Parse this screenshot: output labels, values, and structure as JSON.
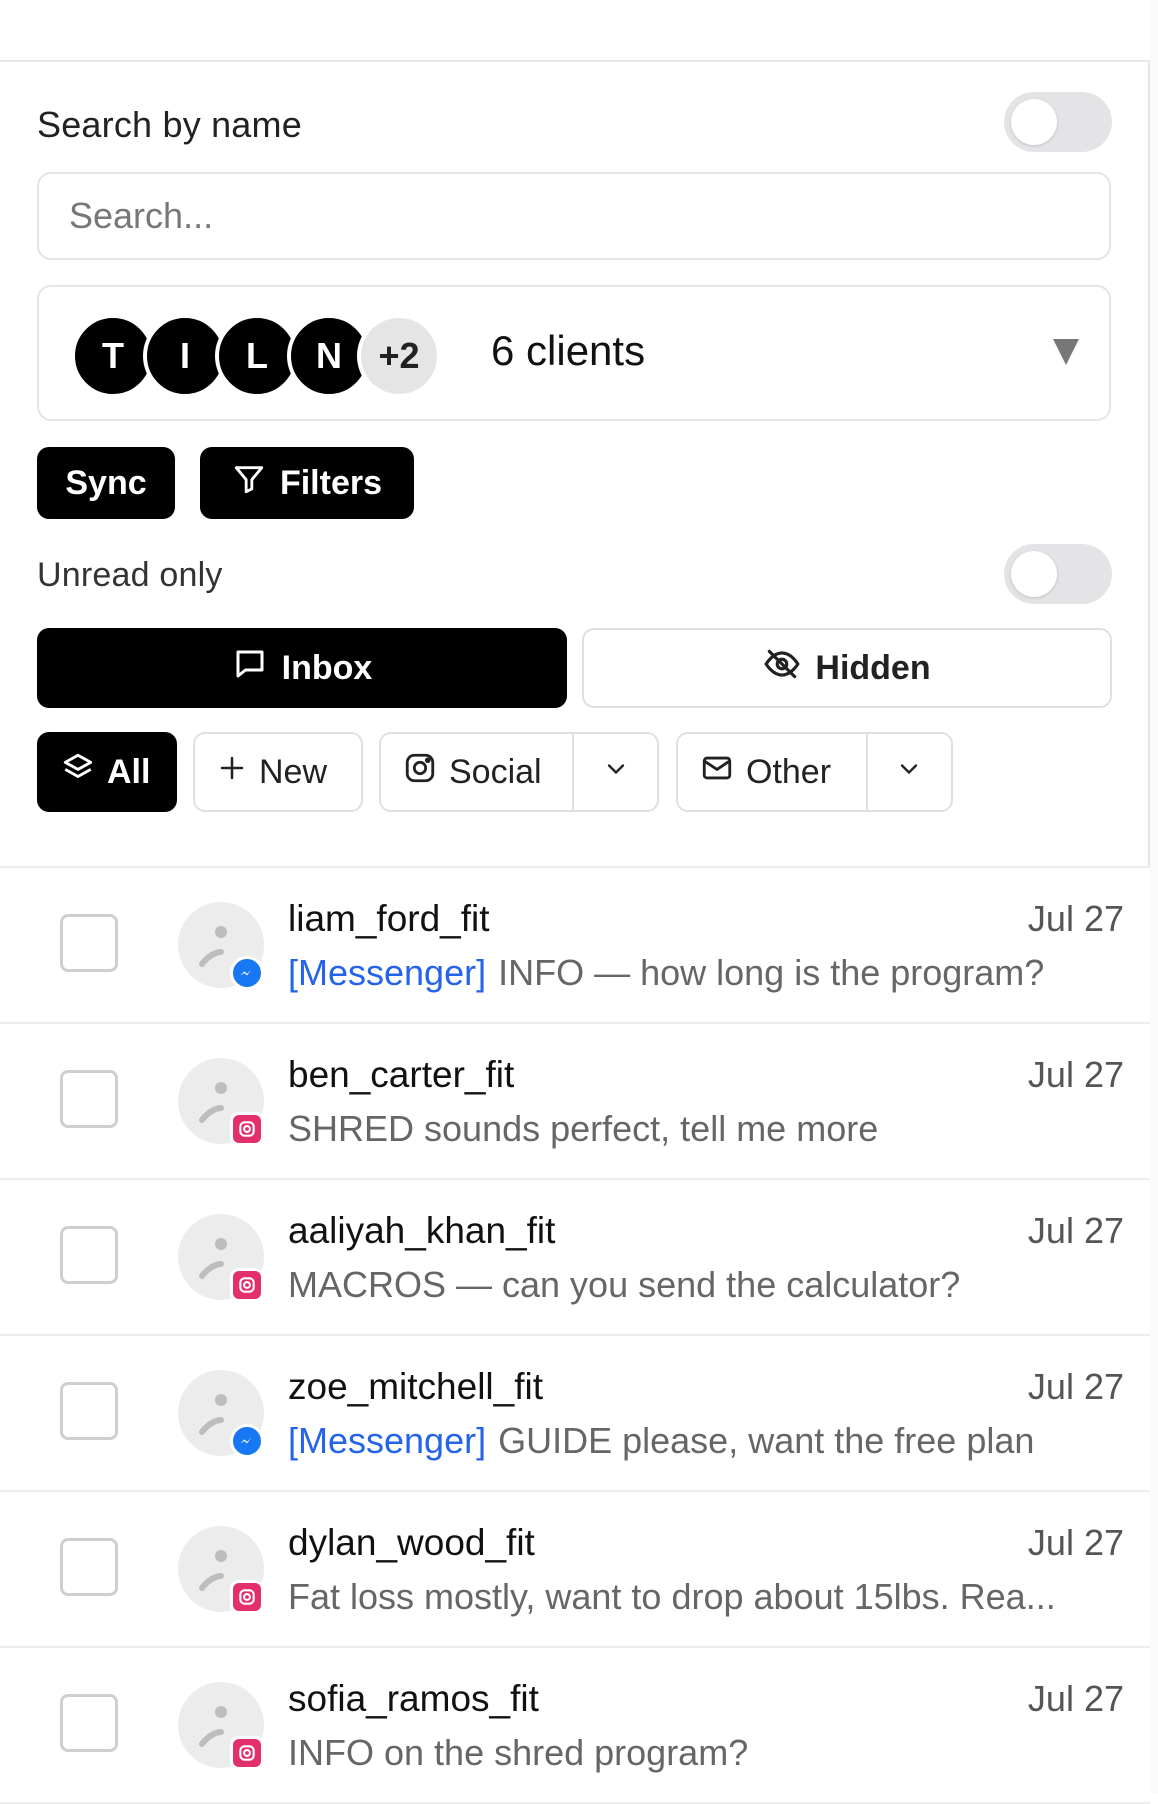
{
  "search": {
    "label": "Search by name",
    "placeholder": "Search...",
    "value": ""
  },
  "clients": {
    "avatars": [
      "T",
      "I",
      "L",
      "N"
    ],
    "more": "+2",
    "label": "6 clients"
  },
  "actions": {
    "sync_label": "Sync",
    "filters_label": "Filters"
  },
  "unread": {
    "label": "Unread only"
  },
  "tabs": [
    {
      "label": "Inbox",
      "icon": "message-square-icon"
    },
    {
      "label": "Hidden",
      "icon": "eye-off-icon"
    }
  ],
  "chips": [
    {
      "label": "All",
      "icon": "layers-icon"
    },
    {
      "label": "New",
      "icon": "plus-icon"
    },
    {
      "label": "Social",
      "icon": "instagram-icon"
    },
    {
      "label": "Other",
      "icon": "mail-icon"
    }
  ],
  "conversations": [
    {
      "name": "liam_ford_fit",
      "date": "Jul 27",
      "tag": "[Messenger]",
      "text": "INFO — how long is the program?",
      "platform": "messenger"
    },
    {
      "name": "ben_carter_fit",
      "date": "Jul 27",
      "tag": "",
      "text": "SHRED sounds perfect, tell me more",
      "platform": "instagram"
    },
    {
      "name": "aaliyah_khan_fit",
      "date": "Jul 27",
      "tag": "",
      "text": "MACROS — can you send the calculator?",
      "platform": "instagram"
    },
    {
      "name": "zoe_mitchell_fit",
      "date": "Jul 27",
      "tag": "[Messenger]",
      "text": "GUIDE please, want the free plan",
      "platform": "messenger"
    },
    {
      "name": "dylan_wood_fit",
      "date": "Jul 27",
      "tag": "",
      "text": "Fat loss mostly, want to drop about 15lbs. Rea...",
      "platform": "instagram"
    },
    {
      "name": "sofia_ramos_fit",
      "date": "Jul 27",
      "tag": "",
      "text": "INFO on the shred program?",
      "platform": "instagram"
    }
  ],
  "colors": {
    "accent": "#000000",
    "messenger": "#1877f2",
    "instagram": "#e1306c",
    "messenger_tag": "#2563eb"
  }
}
